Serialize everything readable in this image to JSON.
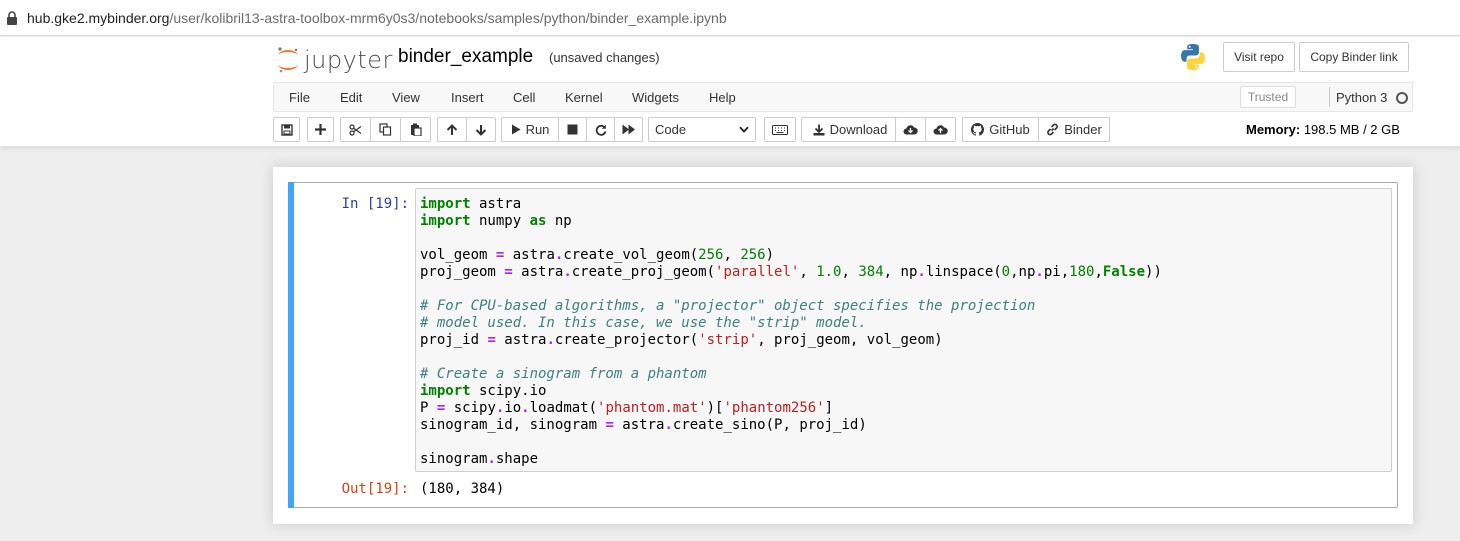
{
  "browser": {
    "url_host": "hub.gke2.mybinder.org",
    "url_path": "/user/kolibril13-astra-toolbox-mrm6y0s3/notebooks/samples/python/binder_example.ipynb"
  },
  "header": {
    "logo_text": "jupyter",
    "notebook_name": "binder_example",
    "save_status": "(unsaved changes)",
    "visit_repo": "Visit repo",
    "copy_binder_link": "Copy Binder link"
  },
  "menu": {
    "items": [
      "File",
      "Edit",
      "View",
      "Insert",
      "Cell",
      "Kernel",
      "Widgets",
      "Help"
    ],
    "trusted": "Trusted",
    "kernel": "Python 3"
  },
  "toolbar": {
    "run": "Run",
    "cell_type": "Code",
    "download": "Download",
    "github": "GitHub",
    "binder": "Binder",
    "memory_label": "Memory:",
    "memory_value": "198.5 MB / 2 GB"
  },
  "cell": {
    "in_prompt": "In [19]:",
    "out_prompt": "Out[19]:",
    "output": "(180, 384)"
  },
  "colors": {
    "cell_selected_bar": "#42a5f5",
    "in_prompt": "#303f9f",
    "out_prompt": "#d84315",
    "keyword": "#008000",
    "string": "#ba2121",
    "comment": "#408080"
  }
}
